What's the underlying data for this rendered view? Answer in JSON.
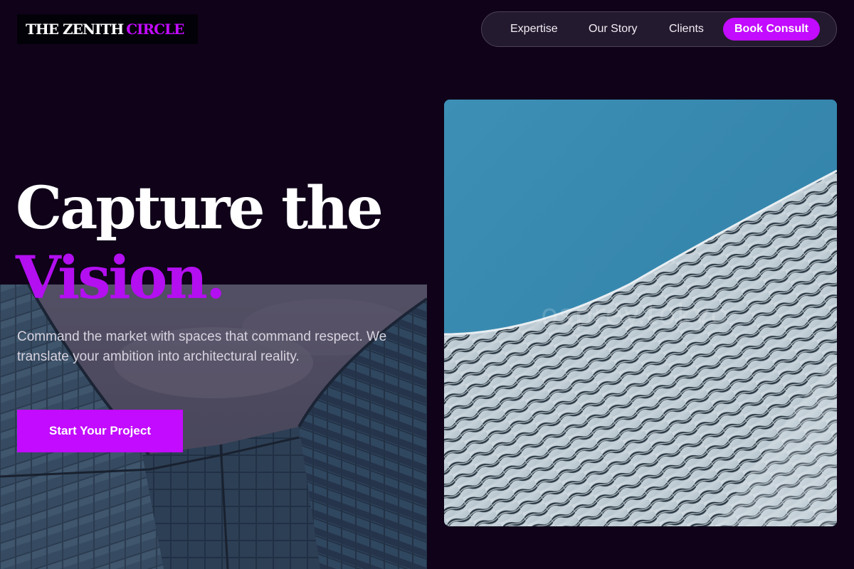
{
  "logo": {
    "word1": "THE ZENITH",
    "word2": "CIRCLE"
  },
  "nav": {
    "items": [
      "Expertise",
      "Our Story",
      "Clients"
    ],
    "cta": "Book Consult"
  },
  "hero": {
    "headline_line1": "Capture the",
    "headline_line2": "Vision.",
    "lede": "Command the market with spaces that command respect. We translate your ambition into architectural reality.",
    "button": "Start Your Project"
  },
  "photo": {
    "watermark": "osprey.tokyo"
  },
  "colors": {
    "background": "#0f0219",
    "accent": "#c20bff",
    "headline_accent": "#b30ff0",
    "sky": "#3b8fb6"
  }
}
